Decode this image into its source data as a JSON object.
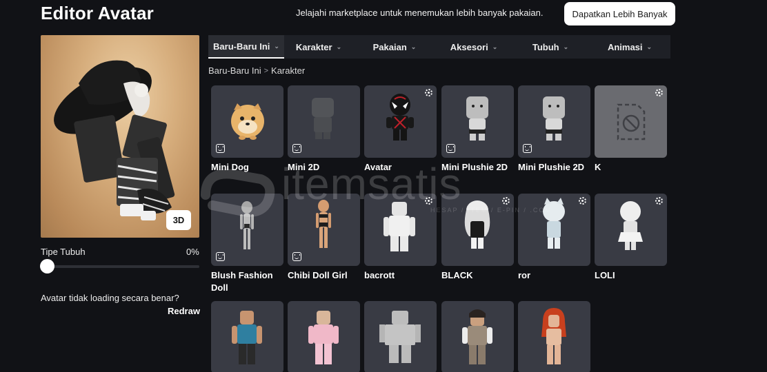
{
  "header": {
    "title": "Editor Avatar",
    "promo_text": "Jelajahi marketplace untuk menemukan lebih banyak pakaian.",
    "promo_button": "Dapatkan Lebih Banyak"
  },
  "preview": {
    "view_button": "3D"
  },
  "body_type": {
    "label": "Tipe Tubuh",
    "value": "0%",
    "level_percent": 0
  },
  "notice": {
    "text": "Avatar tidak loading secara benar?",
    "action": "Redraw"
  },
  "tabs": [
    {
      "label": "Baru-Baru Ini",
      "active": true
    },
    {
      "label": "Karakter",
      "active": false
    },
    {
      "label": "Pakaian",
      "active": false
    },
    {
      "label": "Aksesori",
      "active": false
    },
    {
      "label": "Tubuh",
      "active": false
    },
    {
      "label": "Animasi",
      "active": false
    }
  ],
  "breadcrumb": {
    "parent": "Baru-Baru Ini",
    "separator": ">",
    "current": "Karakter"
  },
  "items": [
    {
      "name": "Mini Dog"
    },
    {
      "name": "Mini 2D"
    },
    {
      "name": "Avatar"
    },
    {
      "name": "Mini Plushie 2D"
    },
    {
      "name": "Mini Plushie 2D"
    },
    {
      "name": "K"
    },
    {
      "name": "Blush Fashion Doll"
    },
    {
      "name": "Chibi Doll Girl"
    },
    {
      "name": "bacrott"
    },
    {
      "name": "BLACK"
    },
    {
      "name": "ror"
    },
    {
      "name": "LOLI"
    }
  ],
  "watermark": {
    "text": "itemsatis",
    "sub": "HESAP / ITEM / E-PIN / .COM"
  },
  "colors": {
    "background": "#111216",
    "tile": "#393b44",
    "accent": "#ffffff"
  }
}
